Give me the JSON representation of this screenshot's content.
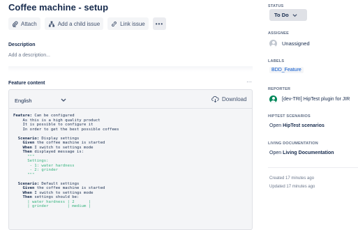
{
  "issue": {
    "title": "Coffee machine - setup"
  },
  "toolbar": {
    "attach_label": "Attach",
    "add_child_label": "Add a child issue",
    "link_issue_label": "Link issue",
    "more_label": "•••"
  },
  "description": {
    "heading": "Description",
    "placeholder": "Add a description..."
  },
  "feature_content": {
    "heading": "Feature content",
    "more_label": "···",
    "language": "English",
    "download_label": "Download",
    "gherkin": {
      "feature_kw": "Feature:",
      "feature_title": " Can be configured",
      "narrative": [
        "    As this is a high quality product",
        "    It is possible to configure it",
        "    In order to get the best possible coffees"
      ],
      "scenario1_kw": "Scenario:",
      "scenario1_title": " Display settings",
      "s1_given_kw": "Given",
      "s1_given": " the coffee machine is started",
      "s1_when_kw": "When",
      "s1_when": " I switch to settings mode",
      "s1_then_kw": "Then",
      "s1_then": " displayed message is:",
      "docstring": [
        "      \"\"\"",
        "      Settings:",
        "       - 1: water hardness",
        "       - 2: grinder",
        "      \"\"\""
      ],
      "scenario2_kw": "Scenario:",
      "scenario2_title": " Default settings",
      "s2_given_kw": "Given",
      "s2_given": " the coffee machine is started",
      "s2_when_kw": "When",
      "s2_when": " I switch to settings mode",
      "s2_then_kw": "Then",
      "s2_then": " settings should be:",
      "table_rows": [
        "      | water hardness | 2      |",
        "      | grinder        | medium |"
      ]
    }
  },
  "sidebar": {
    "status_label": "STATUS",
    "status_value": "To Do",
    "assignee_label": "ASSIGNEE",
    "assignee_value": "Unassigned",
    "labels_label": "LABELS",
    "labels_value": "BDD_Feature",
    "reporter_label": "REPORTER",
    "reporter_value": "[dev-TRI] HipTest plugin for JIR",
    "hiptest_label": "HIPTEST SCENARIOS",
    "hiptest_prefix": "Open ",
    "hiptest_link": "HipTest scenarios",
    "living_label": "LIVING DOCUMENTATION",
    "living_prefix": "Open ",
    "living_link": "Living Documentation",
    "created": "Created 17 minutes ago",
    "updated": "Updated 17 minutes ago"
  },
  "colors": {
    "primary_text": "#172b4d",
    "link_blue": "#0052cc",
    "docstring_green": "#36b37e",
    "reporter_avatar": "#00875a"
  }
}
